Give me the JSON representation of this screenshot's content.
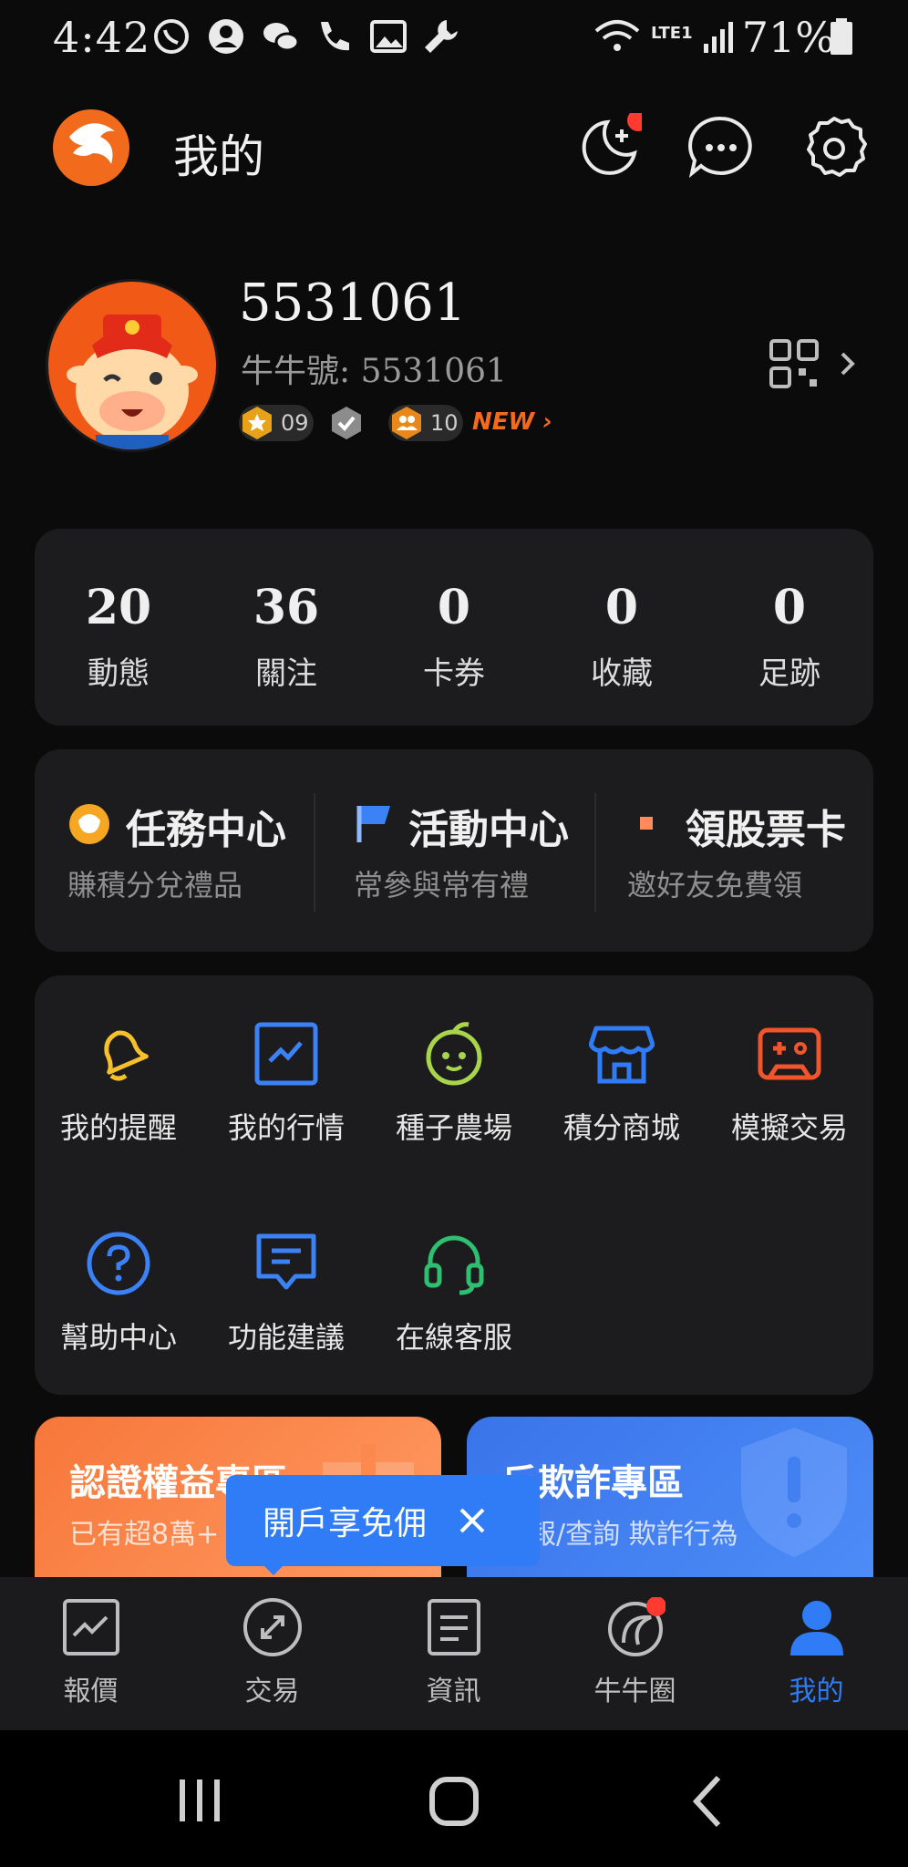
{
  "status_bar": {
    "time": "4:42",
    "battery": "71%",
    "network": "LTE1"
  },
  "header": {
    "title": "我的"
  },
  "profile": {
    "username": "5531061",
    "niu_id": "牛牛號: 5531061",
    "level_badge": "09",
    "fans_badge": "10",
    "new_label": "NEW"
  },
  "stats": [
    {
      "value": "20",
      "label": "動態"
    },
    {
      "value": "36",
      "label": "關注"
    },
    {
      "value": "0",
      "label": "卡券"
    },
    {
      "value": "0",
      "label": "收藏"
    },
    {
      "value": "0",
      "label": "足跡"
    }
  ],
  "services": [
    {
      "title": "任務中心",
      "subtitle": "賺積分兌禮品"
    },
    {
      "title": "活動中心",
      "subtitle": "常參與常有禮"
    },
    {
      "title": "領股票卡",
      "subtitle": "邀好友免費領"
    }
  ],
  "tools": [
    {
      "label": "我的提醒",
      "icon": "bell-icon",
      "color": "#f5c02a"
    },
    {
      "label": "我的行情",
      "icon": "chart-icon",
      "color": "#3b82f6"
    },
    {
      "label": "種子農場",
      "icon": "sprout-face-icon",
      "color": "#a8d54a"
    },
    {
      "label": "積分商城",
      "icon": "store-icon",
      "color": "#2f7cf6"
    },
    {
      "label": "模擬交易",
      "icon": "gamepad-icon",
      "color": "#f2552c"
    },
    {
      "label": "幫助中心",
      "icon": "help-icon",
      "color": "#3b82f6"
    },
    {
      "label": "功能建議",
      "icon": "feedback-icon",
      "color": "#3b82f6"
    },
    {
      "label": "在線客服",
      "icon": "headset-icon",
      "color": "#2fbf71"
    }
  ],
  "banners": [
    {
      "title": "認證權益專區",
      "subtitle": "已有超8萬+"
    },
    {
      "title": "反欺詐專區",
      "subtitle": "舉報/查詢 欺詐行為"
    }
  ],
  "tooltip": {
    "text": "開戶享免佣"
  },
  "bottom_nav": [
    {
      "label": "報價",
      "active": false
    },
    {
      "label": "交易",
      "active": false
    },
    {
      "label": "資訊",
      "active": false
    },
    {
      "label": "牛牛圈",
      "active": false
    },
    {
      "label": "我的",
      "active": true
    }
  ],
  "colors": {
    "accent": "#2f7cf6",
    "brand": "#f26b1d",
    "notify": "#ff3b30"
  }
}
